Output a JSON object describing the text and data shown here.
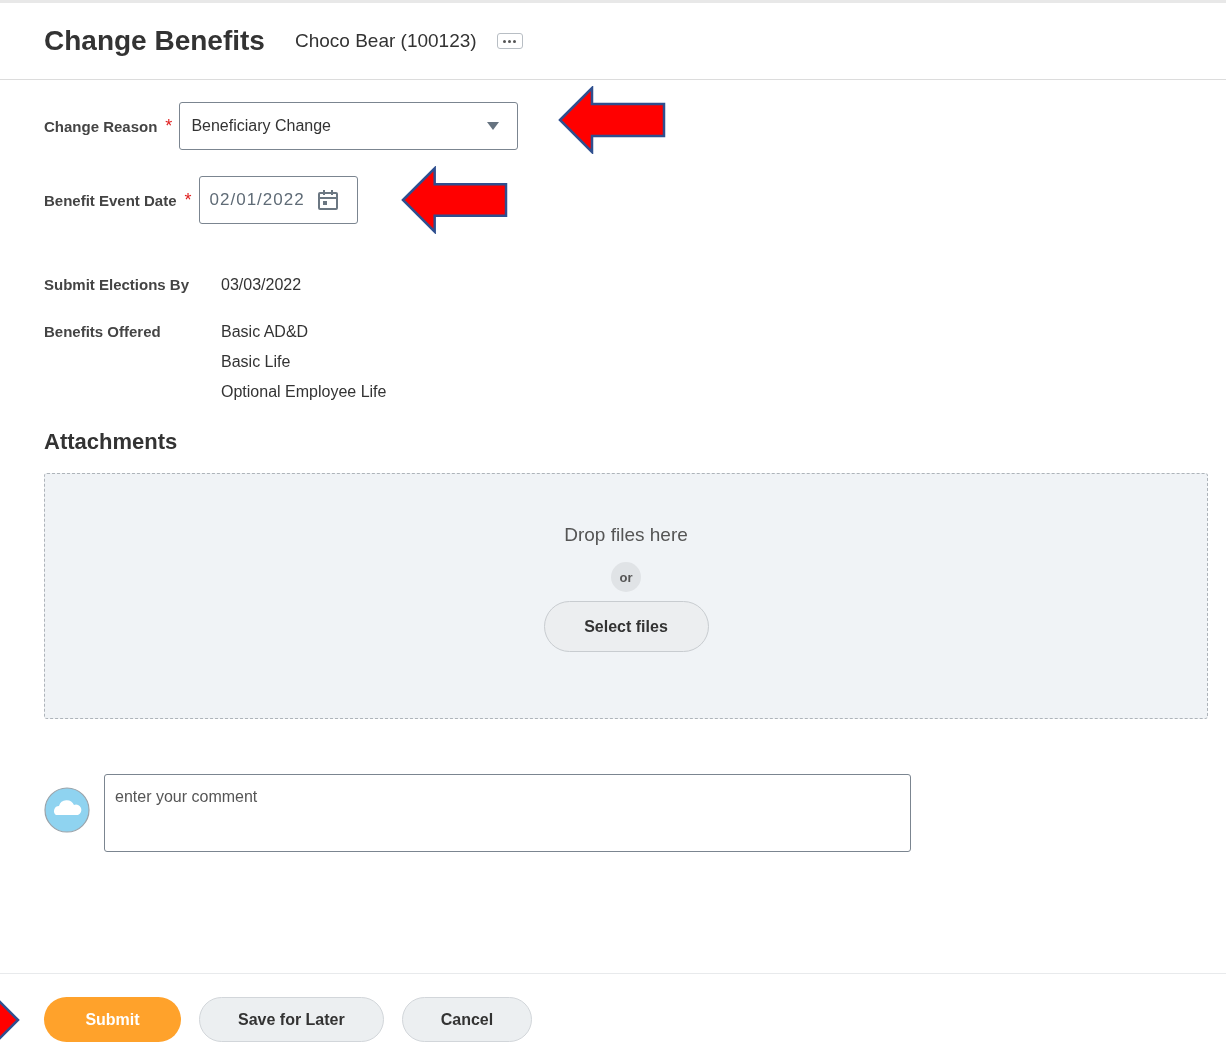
{
  "header": {
    "title": "Change Benefits",
    "subtitle": "Choco Bear (100123)"
  },
  "fields": [
    {
      "kind": "select",
      "label": "Change Reason",
      "required_mark": "*",
      "value": "Beneficiary Change"
    },
    {
      "kind": "date",
      "label": "Benefit Event Date",
      "required_mark": "*",
      "value": "02/01/2022"
    }
  ],
  "details": [
    {
      "label": "Submit Elections By",
      "values": [
        "03/03/2022"
      ]
    },
    {
      "label": "Benefits Offered",
      "values": [
        "Basic AD&D",
        "Basic Life",
        "Optional Employee Life"
      ]
    }
  ],
  "attachments": {
    "title": "Attachments",
    "drop_text": "Drop files here",
    "or_text": "or",
    "button": "Select files"
  },
  "comment": {
    "placeholder": "enter your comment"
  },
  "buttons": [
    {
      "label": "Submit",
      "kind": "primary"
    },
    {
      "label": "Save for Later",
      "kind": "secondary"
    },
    {
      "label": "Cancel",
      "kind": "secondary"
    }
  ]
}
